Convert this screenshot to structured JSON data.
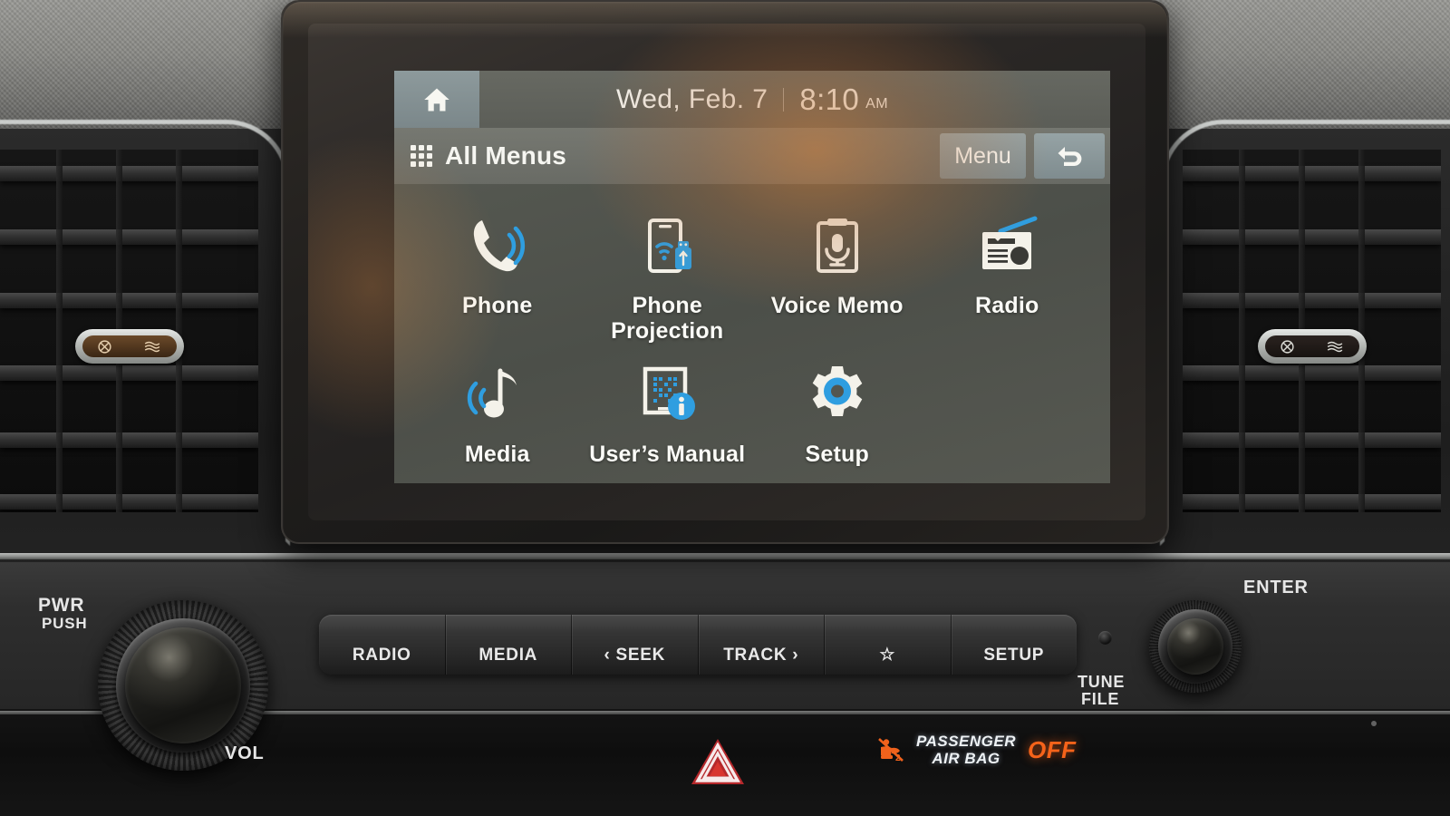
{
  "head_unit": {
    "status_bar": {
      "home_icon": "home-icon",
      "date": "Wed, Feb. 7",
      "time": "8:10",
      "meridiem": "AM"
    },
    "menu_bar": {
      "grid_icon": "grid-icon",
      "title": "All Menus",
      "menu_label": "Menu",
      "back_icon": "back-arrow-icon"
    },
    "apps": [
      {
        "label": "Phone",
        "icon": "phone-icon"
      },
      {
        "label": "Phone\nProjection",
        "label_line1": "Phone",
        "label_line2": "Projection",
        "icon": "phone-projection-icon"
      },
      {
        "label": "Voice Memo",
        "icon": "voice-memo-icon"
      },
      {
        "label": "Radio",
        "icon": "radio-icon"
      },
      {
        "label": "Media",
        "icon": "media-icon"
      },
      {
        "label": "User’s Manual",
        "icon": "users-manual-icon"
      },
      {
        "label": "Setup",
        "icon": "setup-gear-icon"
      }
    ]
  },
  "hard_buttons": [
    {
      "label": "RADIO"
    },
    {
      "label": "MEDIA"
    },
    {
      "label": "‹ SEEK"
    },
    {
      "label": "TRACK ›"
    },
    {
      "label": "☆"
    },
    {
      "label": "SETUP"
    }
  ],
  "knobs": {
    "left": {
      "top_label": "PWR",
      "sub_label": "PUSH",
      "bottom_label": "VOL"
    },
    "right": {
      "top_label": "ENTER",
      "bottom_label_1": "TUNE",
      "bottom_label_2": "FILE"
    }
  },
  "indicators": {
    "hazard": {
      "name": "hazard-warning-button"
    },
    "passenger_airbag": {
      "icon": "airbag-off-icon",
      "line1": "PASSENGER",
      "line2": "AIR BAG",
      "status": "OFF"
    }
  },
  "vents": {
    "left": {
      "name": "air-vent-left",
      "control": "vent-direction-knob"
    },
    "right": {
      "name": "air-vent-right",
      "control": "vent-direction-knob"
    }
  },
  "colors": {
    "accent_blue": "#2f9ee0",
    "icon_white": "#f4f2ea",
    "status_orange": "#f5631a",
    "screen_bg": "#53564f"
  }
}
